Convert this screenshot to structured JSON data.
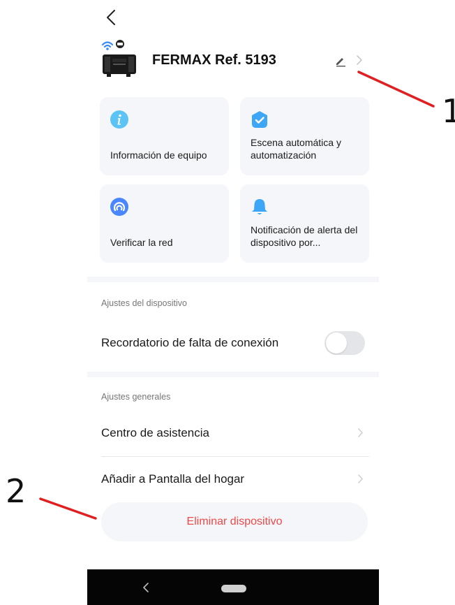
{
  "device": {
    "name": "FERMAX Ref. 5193",
    "icon": "wifi-controller-device-icon"
  },
  "cards": [
    {
      "label": "Información de equipo",
      "icon": "info-icon",
      "color": "#5cc3f5"
    },
    {
      "label": "Escena automática y automatización",
      "icon": "scene-check-icon",
      "color": "#3ea6f6"
    },
    {
      "label": "Verificar la red",
      "icon": "network-check-icon",
      "color": "#4a86ff"
    },
    {
      "label": "Notificación de alerta del dispositivo por...",
      "icon": "bell-icon",
      "color": "#3ea6f6"
    }
  ],
  "device_settings": {
    "section_title": "Ajustes del dispositivo",
    "offline_reminder_label": "Recordatorio de falta de conexión",
    "offline_reminder_enabled": false
  },
  "general_settings": {
    "section_title": "Ajustes generales",
    "help_center_label": "Centro de asistencia",
    "add_home_screen_label": "Añadir a Pantalla del hogar"
  },
  "delete_button_label": "Eliminar dispositivo",
  "annotations": {
    "marker_1": "1",
    "marker_2": "2",
    "color": "#e02020"
  }
}
